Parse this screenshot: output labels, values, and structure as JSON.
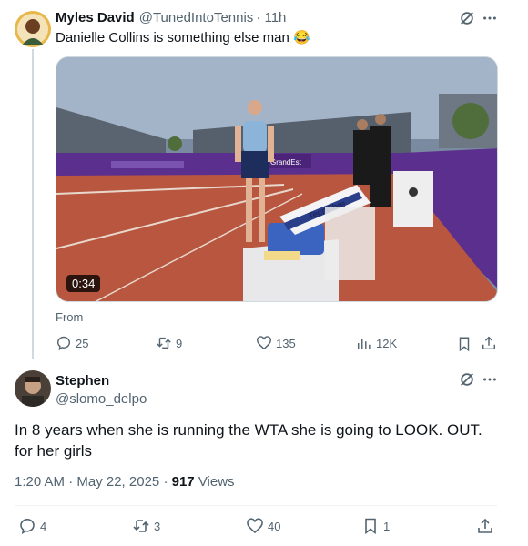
{
  "tweet": {
    "author_name": "Myles David",
    "author_handle": "@TunedIntoTennis",
    "time": "· 11h",
    "text": "Danielle Collins is something else man",
    "emoji": "😂",
    "video_duration": "0:34",
    "from_label": "From",
    "stats": {
      "replies": "25",
      "reposts": "9",
      "likes": "135",
      "views": "12K"
    },
    "media_text": {
      "banner_brand": "GrandEst",
      "bag_brand": "Tecnifibre"
    }
  },
  "reply": {
    "author_name": "Stephen",
    "author_handle": "@slomo_delpo",
    "text": "In 8 years when she is running the WTA she is going to LOOK. OUT. for her girls",
    "time": "1:20 AM · May 22, 2025",
    "views_count": "917",
    "views_label": "Views",
    "stats": {
      "replies": "4",
      "reposts": "3",
      "likes": "40",
      "bookmarks": "1"
    }
  },
  "colors": {
    "secondary_text": "#536471",
    "primary_text": "#0f1419",
    "clay": "#b8563f",
    "court_wall": "#5b2f8e"
  }
}
